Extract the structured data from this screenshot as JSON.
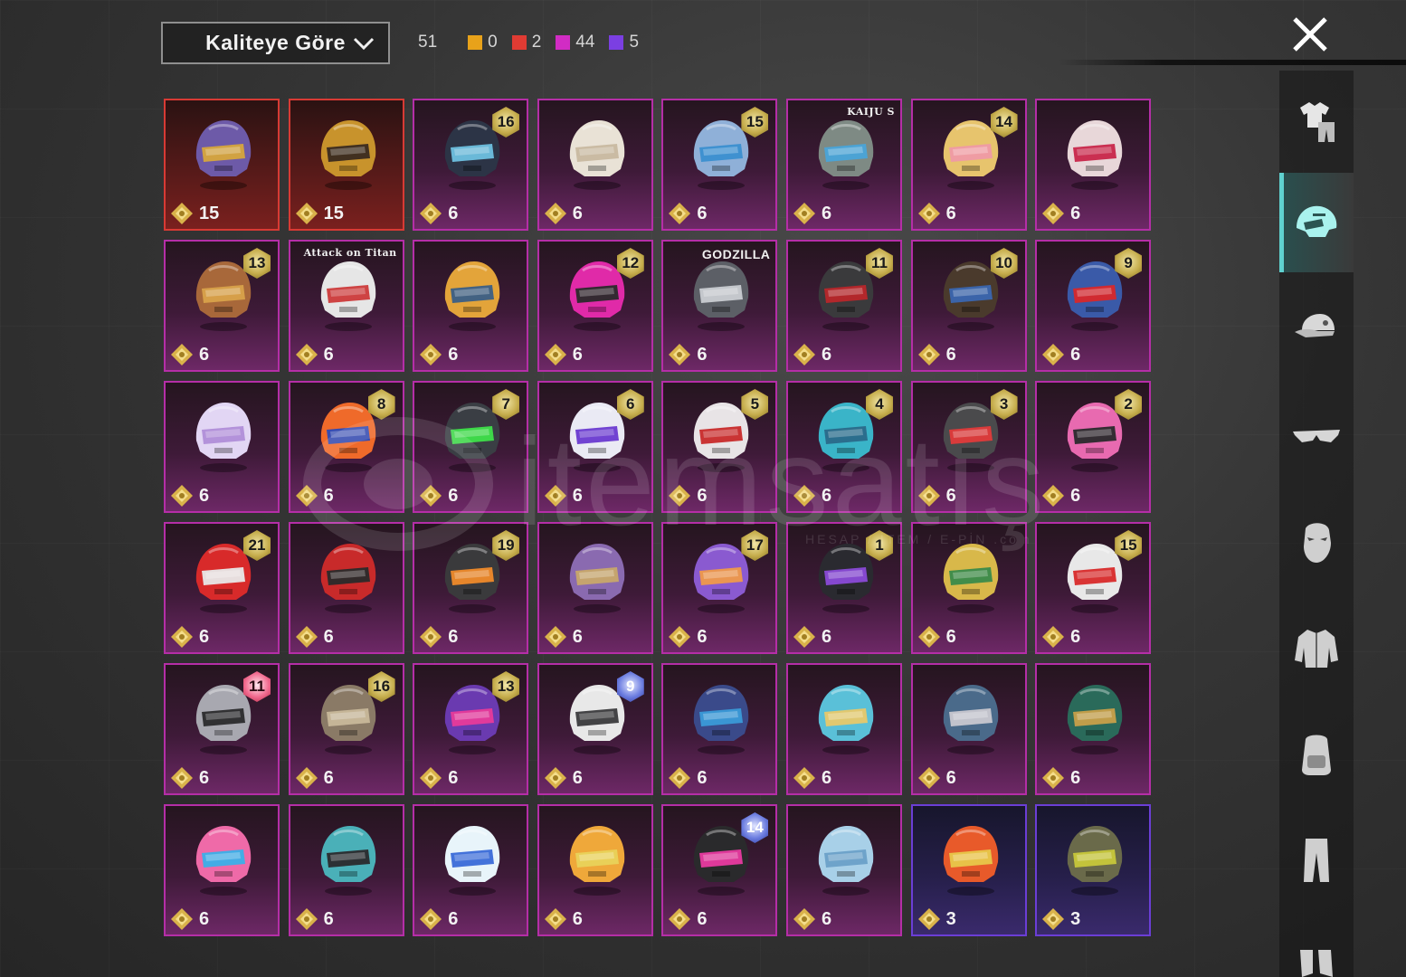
{
  "sort": {
    "label": "Kaliteye Göre",
    "icon": "chevron-down-icon"
  },
  "counts": {
    "total": "51",
    "items": [
      {
        "name": "orange",
        "color": "#e8a21a",
        "value": "0"
      },
      {
        "name": "red",
        "color": "#e03b33",
        "value": "2"
      },
      {
        "name": "magenta",
        "color": "#d12cc4",
        "value": "44"
      },
      {
        "name": "purple",
        "color": "#7b3fe2",
        "value": "5"
      }
    ]
  },
  "close": {
    "icon": "close-icon"
  },
  "watermark": {
    "text": "itemsatış",
    "sub": "HESAP / İTEM / E-PİN .com"
  },
  "sidebar": {
    "items": [
      {
        "name": "outfit",
        "icon": "outfit-icon",
        "active": false
      },
      {
        "name": "helmet",
        "icon": "helmet-icon",
        "active": true
      },
      {
        "name": "hat",
        "icon": "cap-icon",
        "active": false
      },
      {
        "name": "glasses",
        "icon": "glasses-icon",
        "active": false
      },
      {
        "name": "mask",
        "icon": "mask-icon",
        "active": false
      },
      {
        "name": "jacket",
        "icon": "jacket-icon",
        "active": false
      },
      {
        "name": "backpack",
        "icon": "backpack-icon",
        "active": false
      },
      {
        "name": "pants",
        "icon": "pants-icon",
        "active": false
      },
      {
        "name": "shoes",
        "icon": "shoes-icon",
        "active": false
      }
    ]
  },
  "tiles": [
    {
      "q": "red",
      "count": "15",
      "badge": "",
      "brand": "",
      "c1": "#6d5aa8",
      "c2": "#d7a63c"
    },
    {
      "q": "red",
      "count": "15",
      "badge": "",
      "brand": "",
      "c1": "#c8932c",
      "c2": "#3a2a20"
    },
    {
      "q": "magenta",
      "count": "6",
      "badge": "16",
      "brand": "",
      "c1": "#2c3446",
      "c2": "#6ec1e0"
    },
    {
      "q": "magenta",
      "count": "6",
      "badge": "",
      "brand": "",
      "c1": "#e9e2d6",
      "c2": "#c8b8a0"
    },
    {
      "q": "magenta",
      "count": "6",
      "badge": "15",
      "brand": "",
      "c1": "#8fb0d8",
      "c2": "#3b8fd0"
    },
    {
      "q": "magenta",
      "count": "6",
      "badge": "",
      "brand": "KAIJU S",
      "c1": "#7e8a84",
      "c2": "#4aa4d8"
    },
    {
      "q": "magenta",
      "count": "6",
      "badge": "14",
      "brand": "",
      "c1": "#e7c46d",
      "c2": "#ef9aa6"
    },
    {
      "q": "magenta",
      "count": "6",
      "badge": "",
      "brand": "",
      "c1": "#e8d7d9",
      "c2": "#c8264a"
    },
    {
      "q": "magenta",
      "count": "6",
      "badge": "13",
      "brand": "",
      "c1": "#a8683a",
      "c2": "#d8a24a"
    },
    {
      "q": "magenta",
      "count": "6",
      "badge": "",
      "brand": "Attack on Titan",
      "c1": "#e6e6e6",
      "c2": "#cc3a3a"
    },
    {
      "q": "magenta",
      "count": "6",
      "badge": "",
      "brand": "",
      "c1": "#e3a43a",
      "c2": "#3a5f86"
    },
    {
      "q": "magenta",
      "count": "6",
      "badge": "12",
      "brand": "",
      "c1": "#e02aa8",
      "c2": "#2a2a2a"
    },
    {
      "q": "magenta",
      "count": "6",
      "badge": "",
      "brand": "GODZILLA",
      "c1": "#5c5f66",
      "c2": "#c9ccd2"
    },
    {
      "q": "magenta",
      "count": "6",
      "badge": "11",
      "brand": "",
      "c1": "#3a3a3c",
      "c2": "#b8262a"
    },
    {
      "q": "magenta",
      "count": "6",
      "badge": "10",
      "brand": "",
      "c1": "#4a3a2c",
      "c2": "#3a66b0"
    },
    {
      "q": "magenta",
      "count": "6",
      "badge": "9",
      "brand": "",
      "c1": "#3a5aa8",
      "c2": "#d8282a"
    },
    {
      "q": "magenta",
      "count": "6",
      "badge": "",
      "brand": "",
      "c1": "#e2d6f4",
      "c2": "#b08ed8"
    },
    {
      "q": "magenta",
      "count": "6",
      "badge": "8",
      "brand": "",
      "c1": "#ef6a2a",
      "c2": "#2a4ab8"
    },
    {
      "q": "magenta",
      "count": "6",
      "badge": "7",
      "brand": "",
      "c1": "#3a3e44",
      "c2": "#3ee04a"
    },
    {
      "q": "magenta",
      "count": "6",
      "badge": "6",
      "brand": "",
      "c1": "#eaeaf4",
      "c2": "#6a3ad0"
    },
    {
      "q": "magenta",
      "count": "6",
      "badge": "5",
      "brand": "",
      "c1": "#e8e4e6",
      "c2": "#c82a2a"
    },
    {
      "q": "magenta",
      "count": "6",
      "badge": "4",
      "brand": "",
      "c1": "#3ab4c8",
      "c2": "#2a6a8a"
    },
    {
      "q": "magenta",
      "count": "6",
      "badge": "3",
      "brand": "",
      "c1": "#4a4a4c",
      "c2": "#e03a3a"
    },
    {
      "q": "magenta",
      "count": "6",
      "badge": "2",
      "brand": "",
      "c1": "#e86ab0",
      "c2": "#2a2a2c"
    },
    {
      "q": "magenta",
      "count": "6",
      "badge": "21",
      "brand": "",
      "c1": "#d82a2a",
      "c2": "#e8e8e8"
    },
    {
      "q": "magenta",
      "count": "6",
      "badge": "",
      "brand": "",
      "c1": "#c82a2a",
      "c2": "#2a2a2a"
    },
    {
      "q": "magenta",
      "count": "6",
      "badge": "19",
      "brand": "",
      "c1": "#3a3a3c",
      "c2": "#ef8a2a"
    },
    {
      "q": "magenta",
      "count": "6",
      "badge": "",
      "brand": "",
      "c1": "#8a6ab0",
      "c2": "#c8a86a"
    },
    {
      "q": "magenta",
      "count": "6",
      "badge": "17",
      "brand": "",
      "c1": "#8a5ad0",
      "c2": "#ef9a4a"
    },
    {
      "q": "magenta",
      "count": "6",
      "badge": "1",
      "brand": "",
      "c1": "#2a2a30",
      "c2": "#8a4ad8"
    },
    {
      "q": "magenta",
      "count": "6",
      "badge": "",
      "brand": "",
      "c1": "#d8b84a",
      "c2": "#3a8a4a"
    },
    {
      "q": "magenta",
      "count": "6",
      "badge": "15",
      "brand": "",
      "c1": "#e8e8e8",
      "c2": "#d82a2a"
    },
    {
      "q": "magenta",
      "count": "6",
      "badge": "11",
      "badgeStyle": "gem-red",
      "brand": "",
      "c1": "#a8a8b0",
      "c2": "#2a2a2c"
    },
    {
      "q": "magenta",
      "count": "6",
      "badge": "16",
      "brand": "",
      "c1": "#8a7a66",
      "c2": "#c8b89a"
    },
    {
      "q": "magenta",
      "count": "6",
      "badge": "13",
      "brand": "",
      "c1": "#6a3ab0",
      "c2": "#e83a9a"
    },
    {
      "q": "magenta",
      "count": "6",
      "badge": "9",
      "badgeStyle": "gem-blue",
      "brand": "",
      "c1": "#e8e8e8",
      "c2": "#3a3a3c"
    },
    {
      "q": "magenta",
      "count": "6",
      "badge": "",
      "brand": "",
      "c1": "#3a4a8a",
      "c2": "#3a9ad8"
    },
    {
      "q": "magenta",
      "count": "6",
      "badge": "",
      "brand": "",
      "c1": "#5ac0d8",
      "c2": "#e8c86a"
    },
    {
      "q": "magenta",
      "count": "6",
      "badge": "",
      "brand": "",
      "c1": "#4a6a8a",
      "c2": "#c8c8d0"
    },
    {
      "q": "magenta",
      "count": "6",
      "badge": "",
      "brand": "",
      "c1": "#2a6a5a",
      "c2": "#c8a04a"
    },
    {
      "q": "magenta",
      "count": "6",
      "badge": "",
      "brand": "",
      "c1": "#ef6aa8",
      "c2": "#3ab0e8"
    },
    {
      "q": "magenta",
      "count": "6",
      "badge": "",
      "brand": "",
      "c1": "#4ab0b8",
      "c2": "#2a2a2c"
    },
    {
      "q": "magenta",
      "count": "6",
      "badge": "",
      "brand": "",
      "c1": "#e8f4fa",
      "c2": "#3a6ad8"
    },
    {
      "q": "magenta",
      "count": "6",
      "badge": "",
      "brand": "",
      "c1": "#efa83a",
      "c2": "#e8d25a"
    },
    {
      "q": "magenta",
      "count": "6",
      "badge": "14",
      "badgeStyle": "gem-blue",
      "brand": "",
      "c1": "#2a2a2c",
      "c2": "#e83aa0"
    },
    {
      "q": "magenta",
      "count": "6",
      "badge": "",
      "brand": "",
      "c1": "#a8d0e8",
      "c2": "#6aa0c8"
    },
    {
      "q": "blue",
      "count": "3",
      "badge": "",
      "brand": "",
      "c1": "#e85a2a",
      "c2": "#e8c84a"
    },
    {
      "q": "blue",
      "count": "3",
      "badge": "",
      "brand": "",
      "c1": "#6a6a4a",
      "c2": "#c8c83a"
    }
  ]
}
